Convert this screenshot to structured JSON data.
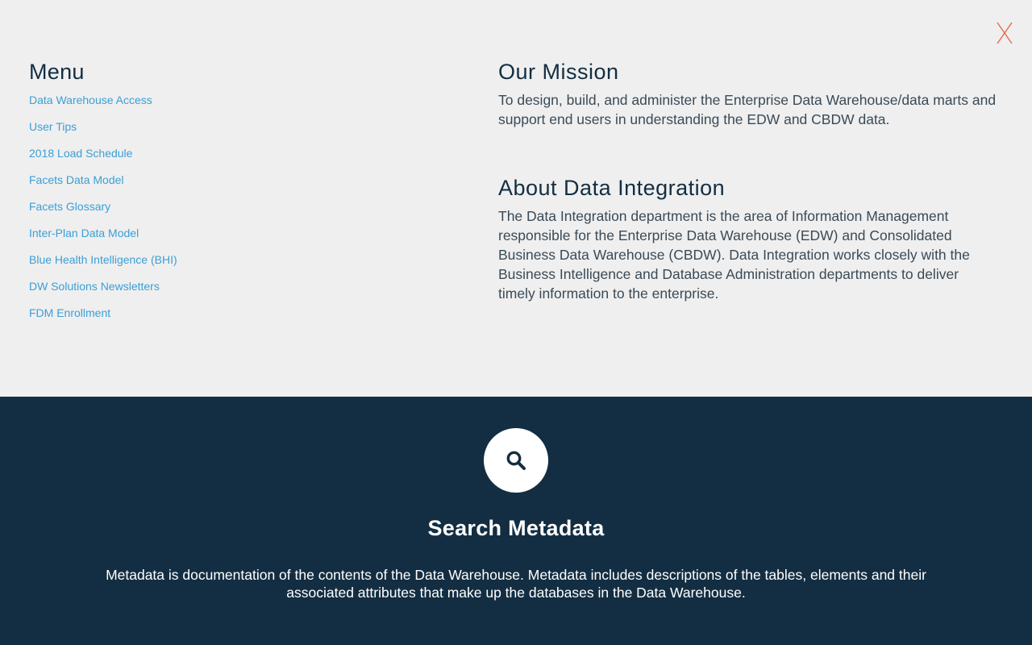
{
  "close": {
    "label": "X"
  },
  "menu": {
    "title": "Menu",
    "items": [
      {
        "label": "Data Warehouse Access"
      },
      {
        "label": "User Tips"
      },
      {
        "label": "2018 Load Schedule"
      },
      {
        "label": "Facets Data Model"
      },
      {
        "label": "Facets Glossary"
      },
      {
        "label": "Inter-Plan Data Model"
      },
      {
        "label": "Blue Health Intelligence (BHI)"
      },
      {
        "label": "DW Solutions Newsletters"
      },
      {
        "label": "FDM Enrollment"
      }
    ]
  },
  "mission": {
    "title": "Our Mission",
    "text": "To design, build, and administer the Enterprise Data Warehouse/data marts and support end users in understanding the EDW and CBDW data."
  },
  "about": {
    "title": "About Data Integration",
    "text": "The Data Integration department is the area of Information Management responsible for the Enterprise Data Warehouse (EDW) and Consolidated Business Data Warehouse (CBDW). Data Integration works closely with the Business Intelligence and Database Administration departments to deliver timely information to the enterprise."
  },
  "search": {
    "icon": "search-icon",
    "title": "Search Metadata",
    "description": "Metadata is documentation of the contents of the Data Warehouse. Metadata includes descriptions of the tables, elements and their associated attributes that make up the databases in the Data Warehouse."
  },
  "colors": {
    "dark_navy": "#132e42",
    "link_blue": "#3a9fd6",
    "close_orange": "#e8694a",
    "background": "#efefef"
  }
}
